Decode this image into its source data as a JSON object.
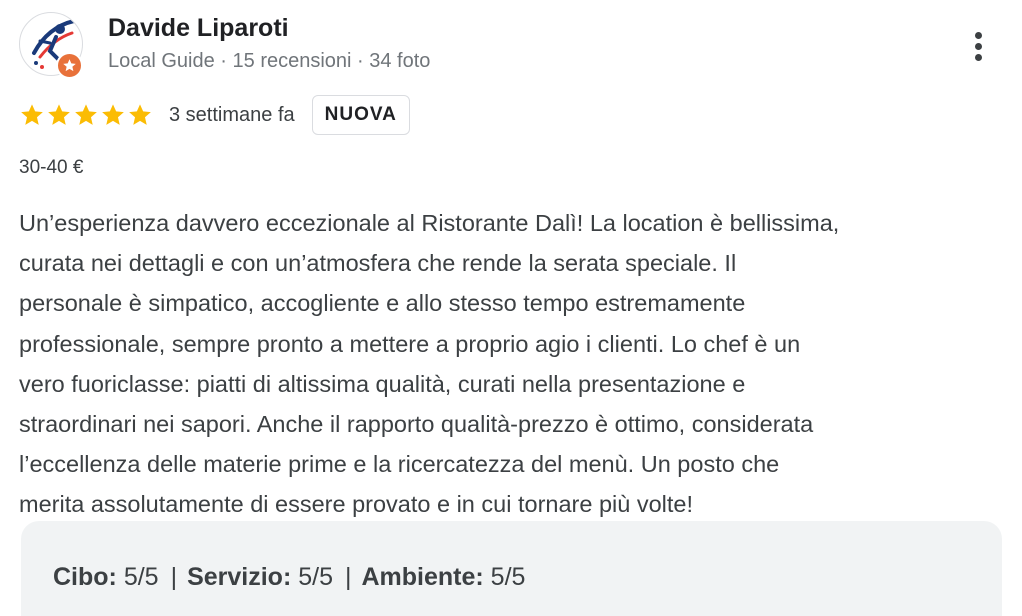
{
  "reviewer": {
    "name": "Davide Liparoti",
    "meta": "Local Guide · 15 recensioni · 34 foto",
    "avatar_icon": "runner-logo-icon",
    "badge_icon": "local-guide-star-icon",
    "badge_color": "#e8713a"
  },
  "menu": {
    "icon": "more-vert-icon"
  },
  "rating": {
    "stars": 5,
    "max_stars": 5,
    "star_color": "#fbbc04",
    "time_ago": "3 settimane fa",
    "new_badge": "NUOVA"
  },
  "price": "30-40 €",
  "review": {
    "text": "Un’esperienza davvero eccezionale al Ristorante Dalì! La location è bellissima,\ncurata nei dettagli e con un’atmosfera che rende la serata speciale. Il\npersonale è simpatico, accogliente e allo stesso tempo estremamente\nprofessionale, sempre pronto a mettere a proprio agio i clienti. Lo chef è un\nvero fuoriclasse: piatti di altissima qualità, curati nella presentazione e\nstraordinari nei sapori. Anche il rapporto qualità-prezzo è ottimo, considerata\nl’eccellenza delle materie prime e la ricercatezza del menù. Un posto che\nmerita assolutamente di essere provato e in cui tornare più volte!"
  },
  "sub_ratings": {
    "items": [
      {
        "label": "Cibo:",
        "value": "5/5"
      },
      {
        "label": "Servizio:",
        "value": "5/5"
      },
      {
        "label": "Ambiente:",
        "value": "5/5"
      }
    ],
    "separator": "|"
  }
}
